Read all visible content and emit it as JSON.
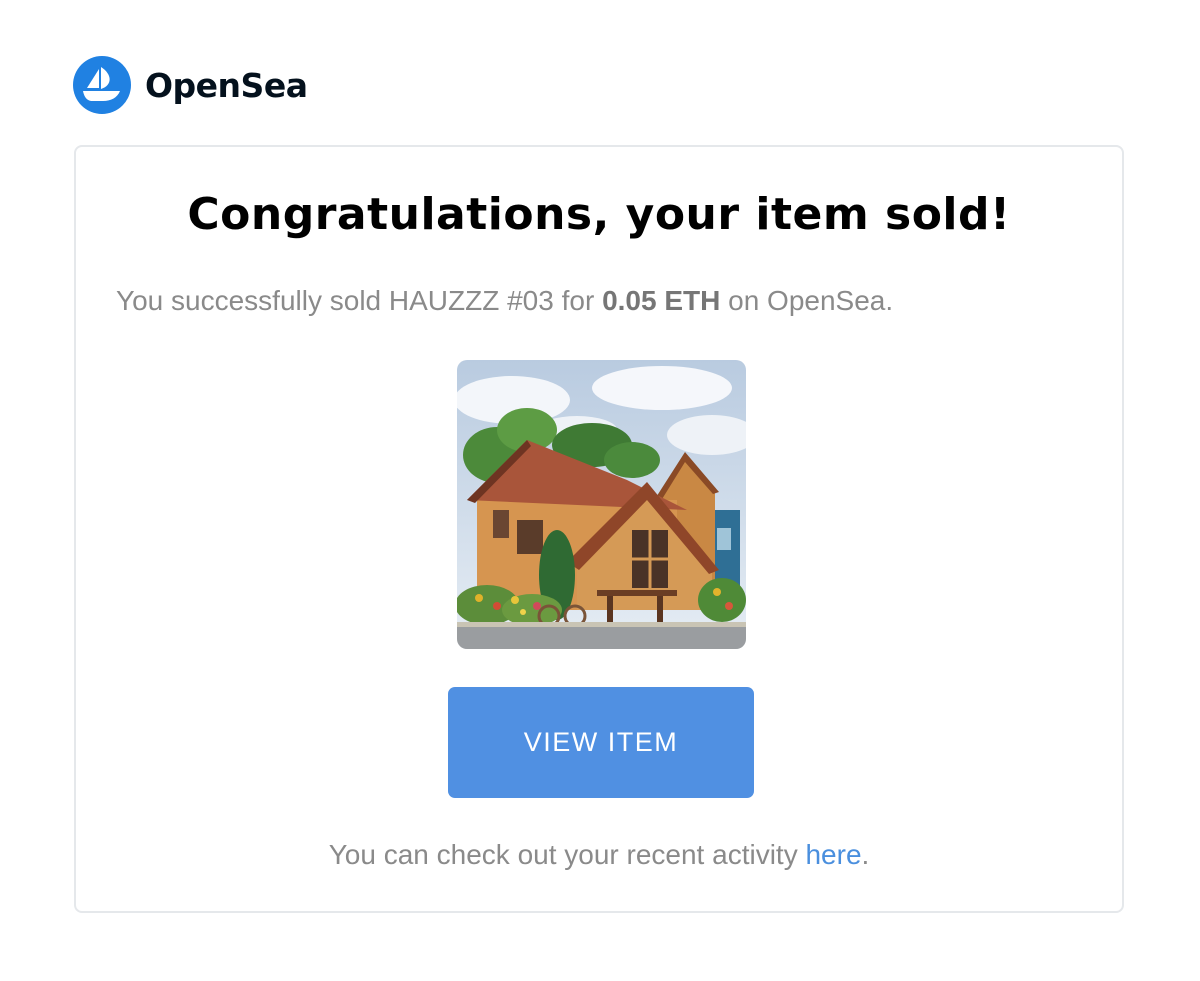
{
  "brand": {
    "name": "OpenSea",
    "logo_icon": "opensea-boat-icon",
    "logo_color": "#2081E2"
  },
  "email": {
    "headline": "Congratulations, your item sold!",
    "message_prefix": "You successfully sold HAUZZZ #03 for ",
    "price": "0.05 ETH",
    "message_suffix": " on OpenSea.",
    "item_image_alt": "HAUZZZ #03",
    "view_button_label": "VIEW ITEM",
    "activity_text": "You can check out your recent activity ",
    "activity_link": "here",
    "activity_end": ".",
    "button_color": "#5090E2",
    "link_color": "#4A8FDE"
  }
}
